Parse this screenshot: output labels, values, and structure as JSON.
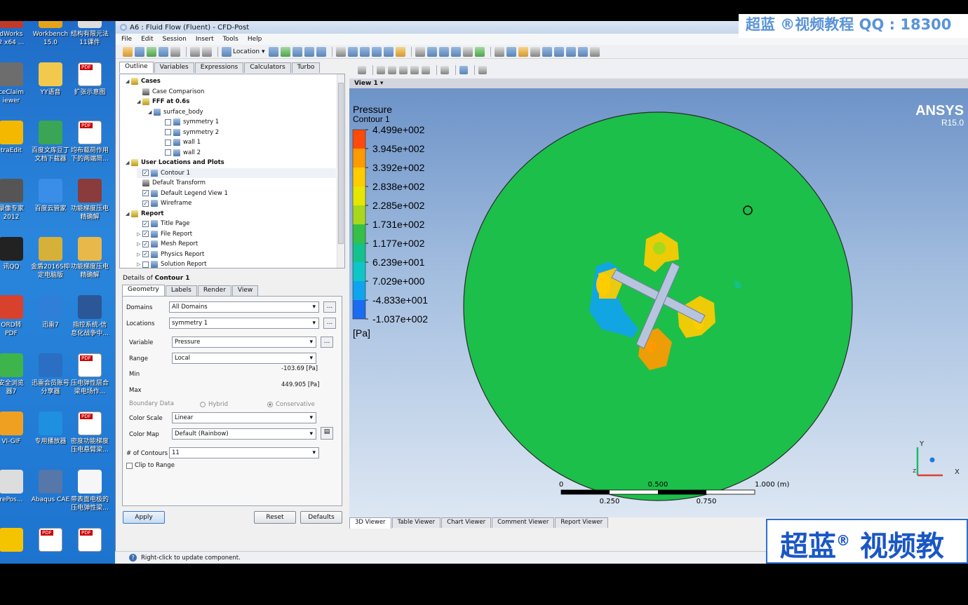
{
  "desktop": {
    "icons": [
      {
        "label": "dWorks\n2 x64 ...",
        "col": 0,
        "row": 0,
        "color": "#c0392b"
      },
      {
        "label": "Workbench\n15.0",
        "col": 1,
        "row": 0,
        "color": "#e3a41a"
      },
      {
        "label": "结构有限元法\n11课件",
        "col": 2,
        "row": 0,
        "color": "#dddddd"
      },
      {
        "label": "ceClaim\niewer",
        "col": 0,
        "row": 1,
        "color": "#6d6d6d"
      },
      {
        "label": "YY语音",
        "col": 1,
        "row": 1,
        "color": "#f2c94c"
      },
      {
        "label": "扩张示意图",
        "col": 2,
        "row": 1,
        "color": "#ffffff",
        "pdf": true
      },
      {
        "label": "traEdit",
        "col": 0,
        "row": 2,
        "color": "#f5b800"
      },
      {
        "label": "百度文库豆丁\n文档下载器",
        "col": 1,
        "row": 2,
        "color": "#3aa655"
      },
      {
        "label": "均布载荷作用\n下的两端简...",
        "col": 2,
        "row": 2,
        "color": "#ffffff",
        "pdf": true
      },
      {
        "label": "录像专家\n2012",
        "col": 0,
        "row": 3,
        "color": "#555555"
      },
      {
        "label": "百度云管家",
        "col": 1,
        "row": 3,
        "color": "#3b8ee8"
      },
      {
        "label": "功能梯度压电\n精确解",
        "col": 2,
        "row": 3,
        "color": "#8a3b3b"
      },
      {
        "label": "讯QQ",
        "col": 0,
        "row": 4,
        "color": "#222222"
      },
      {
        "label": "金盾2016S抑\n定电脑版",
        "col": 1,
        "row": 4,
        "color": "#d6b13a"
      },
      {
        "label": "功能梯度压电\n精确解",
        "col": 2,
        "row": 4,
        "color": "#e8b84a"
      },
      {
        "label": "ORD转\nPDF",
        "col": 0,
        "row": 5,
        "color": "#d8412c"
      },
      {
        "label": "迅雷7",
        "col": 1,
        "row": 5,
        "color": "#2f7fd8"
      },
      {
        "label": "指控系统-信\n息化战争中...",
        "col": 2,
        "row": 5,
        "color": "#2b5797"
      },
      {
        "label": "安全浏览\n器7",
        "col": 0,
        "row": 6,
        "color": "#3db54a"
      },
      {
        "label": "迅雷会员账号\n分享器",
        "col": 1,
        "row": 6,
        "color": "#2a6fc4"
      },
      {
        "label": "压电弹性层合\n梁电场作...",
        "col": 2,
        "row": 6,
        "color": "#ffffff",
        "pdf": true
      },
      {
        "label": "VI-GIF",
        "col": 0,
        "row": 7,
        "color": "#f0a020"
      },
      {
        "label": "专用播放器",
        "col": 1,
        "row": 7,
        "color": "#1f8fe0"
      },
      {
        "label": "密度功能梯度\n压电悬臂梁...",
        "col": 2,
        "row": 7,
        "color": "#ffffff",
        "pdf": true
      },
      {
        "label": "rePos...",
        "col": 0,
        "row": 8,
        "color": "#dddddd"
      },
      {
        "label": "Abaqus CAE",
        "col": 1,
        "row": 8,
        "color": "#5577aa"
      },
      {
        "label": "带表面电极的\n压电弹性梁...",
        "col": 2,
        "row": 8,
        "color": "#f6f6f6"
      },
      {
        "label": "",
        "col": 0,
        "row": 9,
        "color": "#f5c400"
      },
      {
        "label": "",
        "col": 1,
        "row": 9,
        "color": "#ffffff",
        "pdf": true
      },
      {
        "label": "",
        "col": 2,
        "row": 9,
        "color": "#ffffff",
        "pdf": true
      }
    ]
  },
  "window": {
    "title": "A6 : Fluid Flow (Fluent) - CFD-Post",
    "menu": [
      "File",
      "Edit",
      "Session",
      "Insert",
      "Tools",
      "Help"
    ],
    "toolbar": {
      "location_label": "Location"
    }
  },
  "outline": {
    "tabs": [
      "Outline",
      "Variables",
      "Expressions",
      "Calculators",
      "Turbo"
    ],
    "active_tab": "Outline",
    "tree": [
      {
        "label": "Cases",
        "indent": 0,
        "arrow": "◢",
        "icon": "y",
        "bold": true
      },
      {
        "label": "Case Comparison",
        "indent": 1,
        "arrow": "",
        "icon": "d"
      },
      {
        "label": "FFF at 0.6s",
        "indent": 1,
        "arrow": "◢",
        "icon": "y",
        "bold": true
      },
      {
        "label": "surface_body",
        "indent": 2,
        "arrow": "◢",
        "icon": "b"
      },
      {
        "label": "symmetry 1",
        "indent": 3,
        "arrow": "",
        "icon": "b",
        "check": false
      },
      {
        "label": "symmetry 2",
        "indent": 3,
        "arrow": "",
        "icon": "b",
        "check": false
      },
      {
        "label": "wall 1",
        "indent": 3,
        "arrow": "",
        "icon": "b",
        "check": false
      },
      {
        "label": "wall 2",
        "indent": 3,
        "arrow": "",
        "icon": "b",
        "check": false
      },
      {
        "label": "User Locations and Plots",
        "indent": 0,
        "arrow": "◢",
        "icon": "y",
        "bold": true
      },
      {
        "label": "Contour 1",
        "indent": 1,
        "arrow": "",
        "icon": "b",
        "check": true,
        "selected": true
      },
      {
        "label": "Default Transform",
        "indent": 1,
        "arrow": "",
        "icon": "d"
      },
      {
        "label": "Default Legend View 1",
        "indent": 1,
        "arrow": "",
        "icon": "b",
        "check": true
      },
      {
        "label": "Wireframe",
        "indent": 1,
        "arrow": "",
        "icon": "b",
        "check": true
      },
      {
        "label": "Report",
        "indent": 0,
        "arrow": "◢",
        "icon": "y",
        "bold": true
      },
      {
        "label": "Title Page",
        "indent": 1,
        "arrow": "",
        "icon": "b",
        "check": true
      },
      {
        "label": "File Report",
        "indent": 1,
        "arrow": "▷",
        "icon": "b",
        "check": true
      },
      {
        "label": "Mesh Report",
        "indent": 1,
        "arrow": "▷",
        "icon": "b",
        "check": true
      },
      {
        "label": "Physics Report",
        "indent": 1,
        "arrow": "▷",
        "icon": "b",
        "check": true
      },
      {
        "label": "Solution Report",
        "indent": 1,
        "arrow": "▷",
        "icon": "b",
        "check": false
      }
    ]
  },
  "details": {
    "title_prefix": "Details of ",
    "title_object": "Contour 1",
    "tabs": [
      "Geometry",
      "Labels",
      "Render",
      "View"
    ],
    "active_tab": "Geometry",
    "domains_label": "Domains",
    "domains_value": "All Domains",
    "locations_label": "Locations",
    "locations_value": "symmetry 1",
    "variable_label": "Variable",
    "variable_value": "Pressure",
    "range_label": "Range",
    "range_value": "Local",
    "min_label": "Min",
    "min_value": "-103.69 [Pa]",
    "max_label": "Max",
    "max_value": "449.905 [Pa]",
    "boundary_label": "Boundary Data",
    "hybrid_label": "Hybrid",
    "conservative_label": "Conservative",
    "color_scale_label": "Color Scale",
    "color_scale_value": "Linear",
    "color_map_label": "Color Map",
    "color_map_value": "Default (Rainbow)",
    "contours_label": "# of Contours",
    "contours_value": "11",
    "clip_label": "Clip to Range",
    "apply_label": "Apply",
    "reset_label": "Reset",
    "defaults_label": "Defaults",
    "dots": "..."
  },
  "viewer": {
    "view_label": "View 1",
    "legend_title": "Pressure",
    "legend_subtitle": "Contour 1",
    "legend_values": [
      "4.499e+002",
      "3.945e+002",
      "3.392e+002",
      "2.838e+002",
      "2.285e+002",
      "1.731e+002",
      "1.177e+002",
      "6.239e+001",
      "7.029e+000",
      "-4.833e+001",
      "-1.037e+002"
    ],
    "legend_colors": [
      "#ff4a0a",
      "#ff9a00",
      "#ffcc00",
      "#e6e600",
      "#a8d81c",
      "#35c046",
      "#13c28c",
      "#0ec6c8",
      "#10a4ee",
      "#1a6cf0",
      "#1f3be8"
    ],
    "legend_unit": "[Pa]",
    "brand": "ANSYS",
    "version": "R15.0",
    "scale_labels_top": [
      "0",
      "0.500",
      "1.000 (m)"
    ],
    "scale_labels_bottom": [
      "0.250",
      "0.750"
    ],
    "axis_y": "Y",
    "axis_x": "X",
    "axis_z": "Z",
    "domain_color": "#1cbf4a",
    "tabs": [
      "3D Viewer",
      "Table Viewer",
      "Chart Viewer",
      "Comment Viewer",
      "Report Viewer"
    ],
    "active_tab": "3D Viewer"
  },
  "status": {
    "hint": "?",
    "text": "Right-click to update component."
  },
  "watermark": {
    "top": "超蓝 ®视频教程    QQ : 18300",
    "bottom": "超蓝",
    "bottom_reg": "®",
    "bottom_rest": " 视频教"
  }
}
